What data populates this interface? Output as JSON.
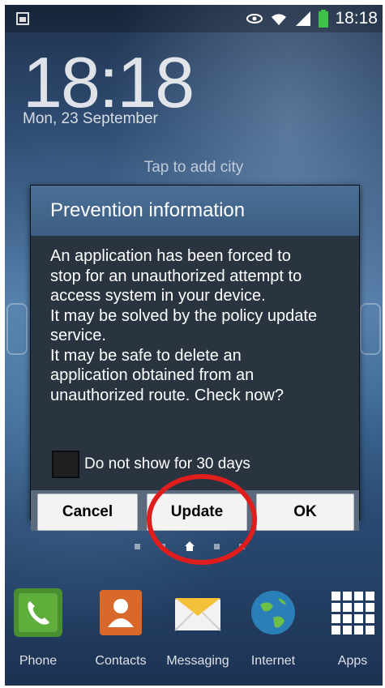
{
  "status_bar": {
    "time": "18:18",
    "icons": [
      "notification-icon",
      "smart-stay-eye-icon",
      "wifi-icon",
      "signal-icon",
      "battery-icon"
    ]
  },
  "lockscreen": {
    "clock": "18:18",
    "date": "Mon, 23 September",
    "weather_hint": "Tap to add city"
  },
  "dialog": {
    "title": "Prevention information",
    "message_lines": [
      "An application has been forced to",
      "stop for an unauthorized attempt to",
      "access system in your device.",
      "It may be solved by the policy update",
      "service.",
      "It may be safe to delete an",
      "application obtained from an",
      "unauthorized route. Check now?"
    ],
    "checkbox_label": "Do not show for 30 days",
    "checkbox_checked": false,
    "buttons": {
      "cancel": "Cancel",
      "update": "Update",
      "ok": "OK"
    }
  },
  "dock": {
    "items": [
      {
        "label": "Phone",
        "icon": "phone-icon"
      },
      {
        "label": "Contacts",
        "icon": "contacts-icon"
      },
      {
        "label": "Messaging",
        "icon": "messaging-icon"
      },
      {
        "label": "Internet",
        "icon": "globe-icon"
      },
      {
        "label": "Apps",
        "icon": "apps-grid-icon"
      }
    ]
  },
  "colors": {
    "dialog_title_bg": "#4a6f96",
    "dialog_bg": "#2a3441",
    "highlight_circle": "#e01d1d"
  }
}
